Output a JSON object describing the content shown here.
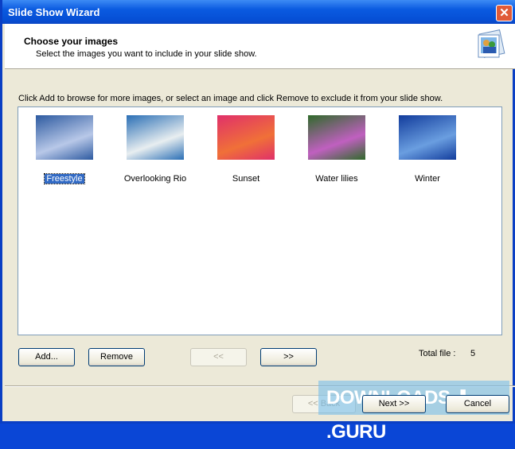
{
  "window": {
    "title": "Slide Show Wizard",
    "close_glyph": "✕"
  },
  "header": {
    "title": "Choose your images",
    "subtitle": "Select the images you want to include in your slide show."
  },
  "instructions": "Click Add to browse for more images, or select an image and click Remove to exclude it from your slide show.",
  "images": [
    {
      "label": "Freestyle",
      "selected": true,
      "colors": [
        "#2d5aa0",
        "#b8c8e8"
      ]
    },
    {
      "label": "Overlooking Rio",
      "selected": false,
      "colors": [
        "#2a6fb5",
        "#e8eef0"
      ]
    },
    {
      "label": "Sunset",
      "selected": false,
      "colors": [
        "#e0306a",
        "#f07038"
      ]
    },
    {
      "label": "Water lilies",
      "selected": false,
      "colors": [
        "#2f6a2a",
        "#c060c0"
      ]
    },
    {
      "label": "Winter",
      "selected": false,
      "colors": [
        "#123c9c",
        "#6a9ee0"
      ]
    }
  ],
  "buttons": {
    "add": "Add...",
    "remove": "Remove",
    "prev": "<<",
    "next_page": ">>",
    "back": "<< Back",
    "next": "Next >>",
    "cancel": "Cancel"
  },
  "total_label": "Total file :",
  "total_count": "5",
  "watermark": "DOWNLOADS ⬇ .GURU"
}
